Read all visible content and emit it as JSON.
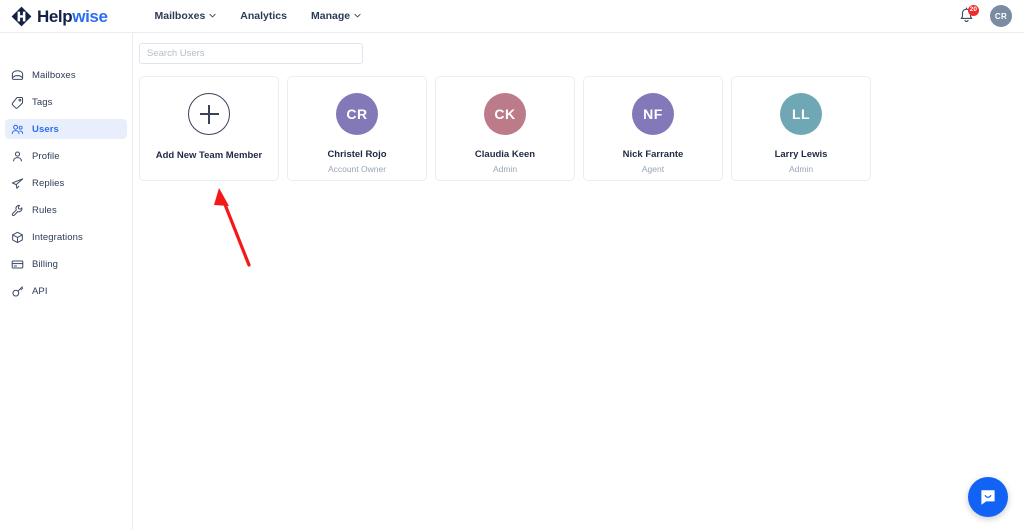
{
  "brand": {
    "name_part1": "Help",
    "name_part2": "wise",
    "logo_icon": "helpwise-diamond-h-logo",
    "colors": {
      "dark": "#16214a",
      "accent": "#2c6ef2"
    }
  },
  "topnav": {
    "items": [
      {
        "label": "Mailboxes",
        "has_dropdown": true
      },
      {
        "label": "Analytics",
        "has_dropdown": false
      },
      {
        "label": "Manage",
        "has_dropdown": true
      }
    ],
    "notifications": {
      "icon": "bell-icon",
      "badge_count": "20",
      "badge_color": "#ef2b2b"
    },
    "account_avatar": {
      "initials": "CR",
      "color": "#7b8ba3"
    }
  },
  "sidebar": {
    "items": [
      {
        "label": "Mailboxes",
        "icon": "mailbox-icon",
        "active": false
      },
      {
        "label": "Tags",
        "icon": "tag-icon",
        "active": false
      },
      {
        "label": "Users",
        "icon": "users-icon",
        "active": true
      },
      {
        "label": "Profile",
        "icon": "person-icon",
        "active": false
      },
      {
        "label": "Replies",
        "icon": "paper-plane-icon",
        "active": false
      },
      {
        "label": "Rules",
        "icon": "wrench-icon",
        "active": false
      },
      {
        "label": "Integrations",
        "icon": "cube-icon",
        "active": false
      },
      {
        "label": "Billing",
        "icon": "credit-card-icon",
        "active": false
      },
      {
        "label": "API",
        "icon": "key-icon",
        "active": false
      }
    ]
  },
  "main": {
    "search": {
      "placeholder": "Search Users",
      "value": ""
    },
    "add_card": {
      "label": "Add New Team Member",
      "icon": "plus-circle-icon"
    },
    "users": [
      {
        "initials": "CR",
        "name": "Christel Rojo",
        "role": "Account Owner",
        "color": "#8378b8"
      },
      {
        "initials": "CK",
        "name": "Claudia Keen",
        "role": "Admin",
        "color": "#bc7b89"
      },
      {
        "initials": "NF",
        "name": "Nick Farrante",
        "role": "Agent",
        "color": "#8378b8"
      },
      {
        "initials": "LL",
        "name": "Larry Lewis",
        "role": "Admin",
        "color": "#6fa8b4"
      }
    ]
  },
  "annotation": {
    "type": "arrow",
    "color": "#f51818",
    "points_to": "add-new-team-member-card"
  },
  "chat_widget": {
    "icon": "chat-bubble-icon",
    "color": "#1263f5"
  }
}
